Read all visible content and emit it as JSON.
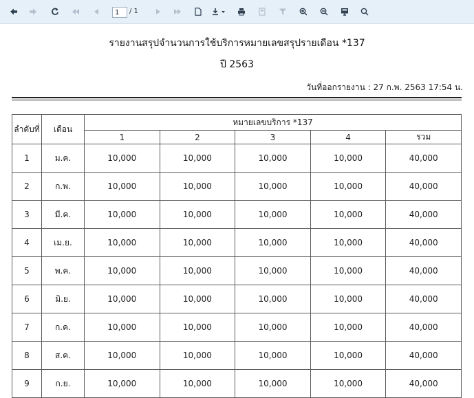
{
  "toolbar": {
    "page_current": "1",
    "page_total": "/ 1",
    "buttons": [
      {
        "name": "back-icon",
        "glyph": "back",
        "enabled": true
      },
      {
        "name": "forward-icon",
        "glyph": "forward",
        "enabled": false
      },
      {
        "name": "refresh-icon",
        "glyph": "refresh",
        "enabled": true
      },
      {
        "name": "first-page-icon",
        "glyph": "first",
        "enabled": false
      },
      {
        "name": "prev-page-icon",
        "glyph": "prev",
        "enabled": false
      },
      {
        "name": "next-page-icon",
        "glyph": "next",
        "enabled": false
      },
      {
        "name": "last-page-icon",
        "glyph": "last",
        "enabled": false
      },
      {
        "name": "document-icon",
        "glyph": "doc",
        "enabled": true
      },
      {
        "name": "export-icon",
        "glyph": "export",
        "enabled": true
      },
      {
        "name": "print-icon",
        "glyph": "print",
        "enabled": true
      },
      {
        "name": "print-layout-icon",
        "glyph": "layout",
        "enabled": false
      },
      {
        "name": "filter-icon",
        "glyph": "filter",
        "enabled": false
      },
      {
        "name": "zoom-in-icon",
        "glyph": "zoomin",
        "enabled": true
      },
      {
        "name": "zoom-out-icon",
        "glyph": "zoomout",
        "enabled": true
      },
      {
        "name": "view-mode-icon",
        "glyph": "view",
        "enabled": true
      },
      {
        "name": "search-icon",
        "glyph": "search",
        "enabled": true
      }
    ]
  },
  "report": {
    "title": "รายงานสรุปจำนวนการใช้บริการหมายเลขสรุปรายเดือน *137",
    "year": "ปี 2563",
    "generated": "วันที่ออกรายงาน : 27 ก.พ. 2563 17:54 น."
  },
  "table": {
    "col_index": "ลำดับที่",
    "col_month": "เดือน",
    "group_header": "หมายเลขบริการ *137",
    "sub_headers": [
      "1",
      "2",
      "3",
      "4",
      "รวม"
    ],
    "rows": [
      {
        "idx": "1",
        "month": "ม.ค.",
        "vals": [
          "10,000",
          "10,000",
          "10,000",
          "10,000",
          "40,000"
        ]
      },
      {
        "idx": "2",
        "month": "ก.พ.",
        "vals": [
          "10,000",
          "10,000",
          "10,000",
          "10,000",
          "40,000"
        ]
      },
      {
        "idx": "3",
        "month": "มี.ค.",
        "vals": [
          "10,000",
          "10,000",
          "10,000",
          "10,000",
          "40,000"
        ]
      },
      {
        "idx": "4",
        "month": "เม.ย.",
        "vals": [
          "10,000",
          "10,000",
          "10,000",
          "10,000",
          "40,000"
        ]
      },
      {
        "idx": "5",
        "month": "พ.ค.",
        "vals": [
          "10,000",
          "10,000",
          "10,000",
          "10,000",
          "40,000"
        ]
      },
      {
        "idx": "6",
        "month": "มิ.ย.",
        "vals": [
          "10,000",
          "10,000",
          "10,000",
          "10,000",
          "40,000"
        ]
      },
      {
        "idx": "7",
        "month": "ก.ค.",
        "vals": [
          "10,000",
          "10,000",
          "10,000",
          "10,000",
          "40,000"
        ]
      },
      {
        "idx": "8",
        "month": "ส.ค.",
        "vals": [
          "10,000",
          "10,000",
          "10,000",
          "10,000",
          "40,000"
        ]
      },
      {
        "idx": "9",
        "month": "ก.ย.",
        "vals": [
          "10,000",
          "10,000",
          "10,000",
          "10,000",
          "40,000"
        ]
      }
    ]
  }
}
